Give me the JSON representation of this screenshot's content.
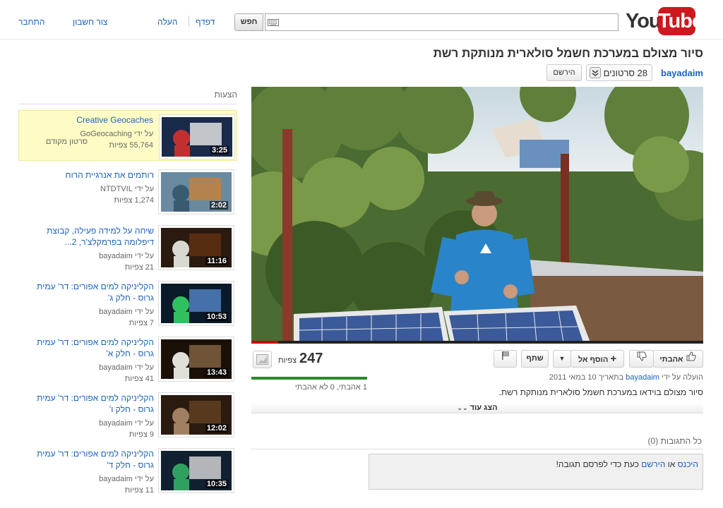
{
  "header": {
    "logo_you": "You",
    "logo_tube": "Tube",
    "search_button": "חפש",
    "search_value": "",
    "nav": {
      "browse": "דפדף",
      "upload": "העלה",
      "create_account": "צור חשבון",
      "sign_in": "התחבר"
    }
  },
  "video": {
    "title": "סיור מצולם במערכת חשמל סולארית מנותקת רשת",
    "channel": "bayadaim",
    "video_count": "28 סרטונים",
    "subscribe": "הירשם",
    "progress_fraction": 0.06,
    "actions": {
      "like": "אהבתי",
      "add_to": "הוסף אל",
      "share": "שתף"
    },
    "view_count": "247",
    "views_label": "צפיות",
    "like_counts": "1 אהבתי, 0 לא אהבתי",
    "upload_prefix": "הועלה על ידי",
    "upload_user": "bayadaim",
    "upload_date": "בתאריך 10 במאי 2011",
    "description": "סיור מצולם בוידאו במערכת חשמל סולארית מנותקת רשת.",
    "show_more": "הצג עוד"
  },
  "comments": {
    "header": "כל התגובות (0)",
    "sign_in_link": "היכנס",
    "or": "או",
    "signup_link": "הירשם",
    "suffix": "כעת כדי לפרסם תגובה!"
  },
  "sidebar": {
    "heading": "הצעות",
    "items": [
      {
        "title": "Creative Geocaches",
        "by": "על ידי GoGeocaching",
        "views": "55,764 צפיות",
        "duration": "3:25",
        "badge": "סרטון מקודם"
      },
      {
        "title": "רותמים את אנרגיית הרוח",
        "by": "על ידי NTDTVIL",
        "views": "1,274 צפיות",
        "duration": "2:02"
      },
      {
        "title": "שיחה על למידה פעילה, קבוצת דיפלומה בפרמקלצ'ר, 2...",
        "by": "על ידי bayadaim",
        "views": "21 צפיות",
        "duration": "11:16"
      },
      {
        "title": "הקליניקה למים אפורים: דר' עמית גרוס - חלק ג'",
        "by": "על ידי bayadaim",
        "views": "7 צפיות",
        "duration": "10:53"
      },
      {
        "title": "הקליניקה למים אפורים: דר' עמית גרוס - חלק א'",
        "by": "על ידי bayadaim",
        "views": "41 צפיות",
        "duration": "13:43"
      },
      {
        "title": "הקליניקה למים אפורים: דר' עמית גרוס - חלק ו'",
        "by": "על ידי bayadaim",
        "views": "9 צפיות",
        "duration": "12:02"
      },
      {
        "title": "הקליניקה למים אפורים: דר' עמית גרוס - חלק ד'",
        "by": "על ידי bayadaim",
        "views": "11 צפיות",
        "duration": "10:35"
      }
    ]
  }
}
